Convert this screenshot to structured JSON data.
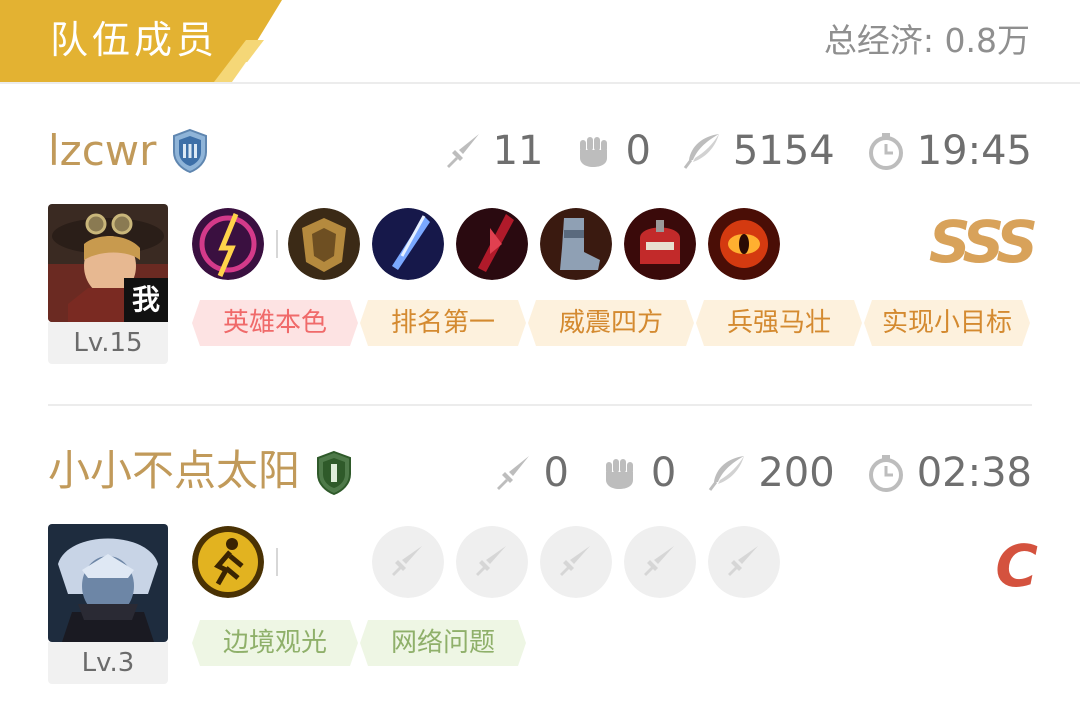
{
  "header": {
    "title": "队伍成员",
    "total_economy": "总经济: 0.8万",
    "accent_color": "#e3b232"
  },
  "players": [
    {
      "name": "lzcwr",
      "rank_icon": "shield-rank-icon",
      "stats": {
        "kills": "11",
        "assists": "0",
        "gold": "5154",
        "time": "19:45"
      },
      "level": "Lv.15",
      "me_badge": "我",
      "rating": "SSS",
      "rating_color": "#d8a25a",
      "items": [
        "spell-icon",
        "armor-icon",
        "blade-icon",
        "crimson-blade-icon",
        "boots-icon",
        "helmet-icon",
        "eye-icon"
      ],
      "tags": [
        {
          "label": "英雄本色",
          "color": "#f06a6a",
          "bg": "#fde3e3"
        },
        {
          "label": "排名第一",
          "color": "#d48a30",
          "bg": "#fdf1dd"
        },
        {
          "label": "威震四方",
          "color": "#d48a30",
          "bg": "#fdf1dd"
        },
        {
          "label": "兵强马壮",
          "color": "#d48a30",
          "bg": "#fdf1dd"
        },
        {
          "label": "实现小目标",
          "color": "#d48a30",
          "bg": "#fdf1dd"
        }
      ]
    },
    {
      "name": "小小不点太阳",
      "rank_icon": "shield-rank-green-icon",
      "stats": {
        "kills": "0",
        "assists": "0",
        "gold": "200",
        "time": "02:38"
      },
      "level": "Lv.3",
      "rating": "C",
      "rating_color": "#d4523e",
      "items": [
        "sprint-spell-icon"
      ],
      "empty_slots": 5,
      "tags": [
        {
          "label": "边境观光",
          "color": "#8fb06a",
          "bg": "#eef6e4"
        },
        {
          "label": "网络问题",
          "color": "#8fb06a",
          "bg": "#eef6e4"
        }
      ]
    }
  ]
}
